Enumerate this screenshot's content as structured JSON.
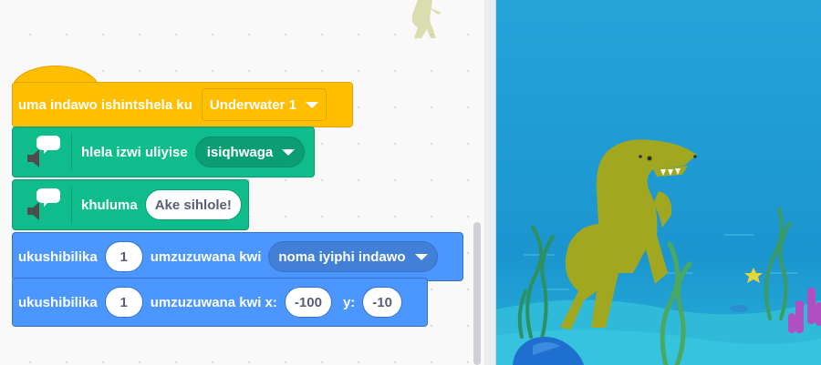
{
  "code_blocks": {
    "switch_backdrop": {
      "label": "uma indawo ishintshela ku",
      "backdrop": "Underwater 1"
    },
    "set_voice": {
      "label": "hlela izwi uliyise",
      "voice": "isiqhwaga"
    },
    "speak": {
      "label": "khuluma",
      "text": "Ake sihlole!"
    },
    "glide_to": {
      "label": "ukushibilika",
      "seconds": "1",
      "label2": "umzuzuwana kwi",
      "target": "noma iyiphi indawo"
    },
    "glide_xy": {
      "label": "ukushibilika",
      "seconds": "1",
      "label2": "umzuzuwana kwi x:",
      "x": "-100",
      "y_label": "y:",
      "y": "-10"
    }
  },
  "colors": {
    "events": "#ffbf00",
    "extension": "#0fbd8c",
    "motion": "#4c97ff",
    "stage_water": "#22a3d6",
    "dinosaur": "#a1a81f"
  },
  "icons": {
    "speech_extension": "speech-bubble-speaker-icon"
  },
  "stage": {
    "sprite": "dinosaur",
    "backdrop_scene": "underwater"
  }
}
